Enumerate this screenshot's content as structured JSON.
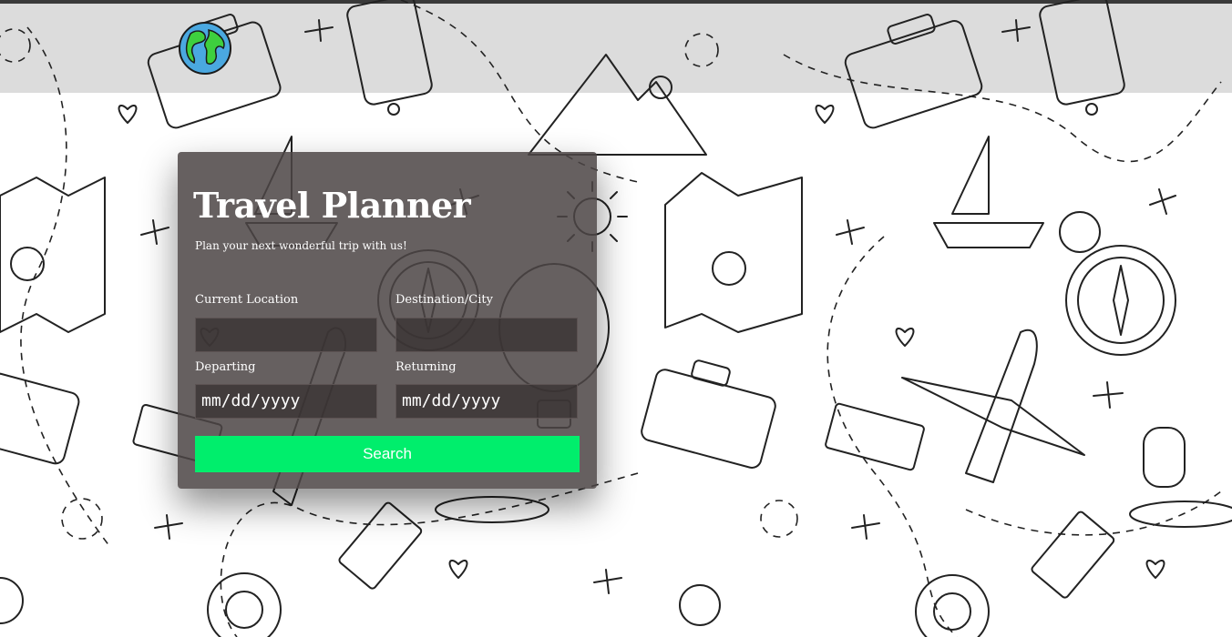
{
  "app": {
    "title": "Travel Planner",
    "subtitle": "Plan your next wonderful trip with us!"
  },
  "header": {
    "logo_icon": "globe-icon"
  },
  "form": {
    "current_location": {
      "label": "Current Location",
      "value": ""
    },
    "destination": {
      "label": "Destination/City",
      "value": ""
    },
    "departing": {
      "label": "Departing",
      "placeholder": "mm/dd/yyyy"
    },
    "returning": {
      "label": "Returning",
      "placeholder": "mm/dd/yyyy"
    },
    "search_label": "Search"
  },
  "colors": {
    "accent": "#00ee6c",
    "card": "#4d4646",
    "header": "#dcdcdc"
  }
}
